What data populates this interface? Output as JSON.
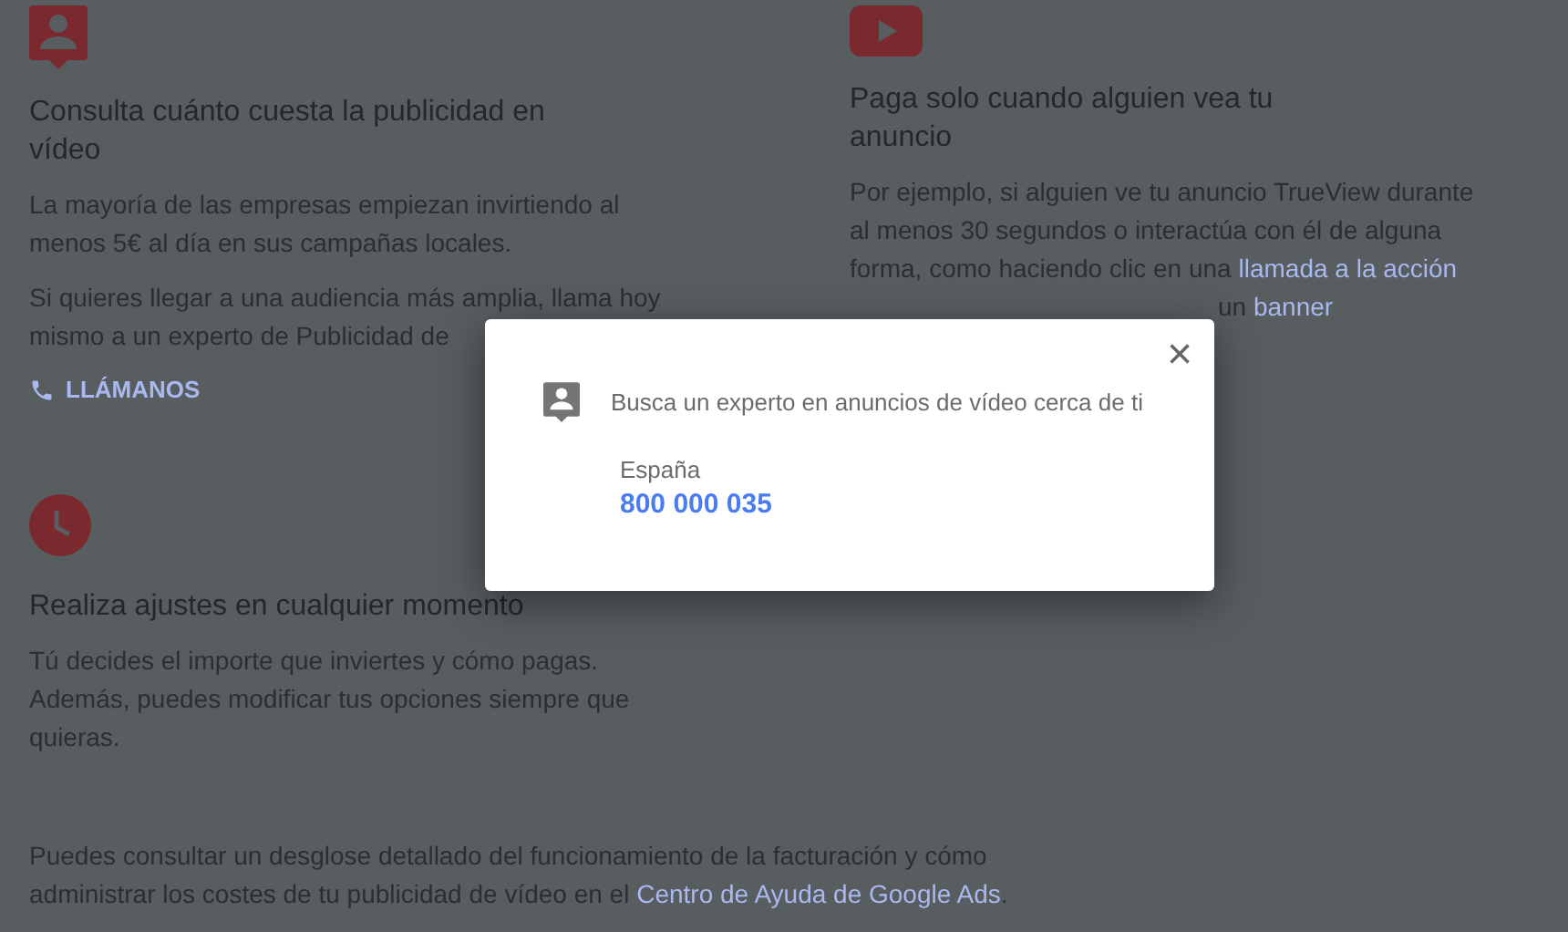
{
  "features": [
    {
      "title": "Consulta cuánto cuesta la publicidad en vídeo",
      "paragraphs": [
        {
          "covered_start": false,
          "segments": [
            {
              "kind": "text",
              "text": "La mayoría de las empresas empiezan invirtiendo al menos 5€ al día en sus campañas locales."
            }
          ]
        },
        {
          "covered_start": false,
          "segments": [
            {
              "kind": "text",
              "text": "Si quieres llegar a una audiencia más amplia, llama hoy mismo a un experto de Publicidad de"
            }
          ]
        }
      ],
      "action": {
        "label": "LLÁMANOS"
      }
    },
    {
      "title": "Paga solo cuando alguien vea tu anuncio",
      "paragraphs": [
        {
          "covered_start": false,
          "segments": [
            {
              "kind": "text",
              "text": "Por ejemplo, si alguien ve tu anuncio TrueView durante al menos 30 segundos o interactúa con él de alguna forma, como haciendo clic en una "
            },
            {
              "kind": "link",
              "text": "llamada a la acción"
            }
          ]
        },
        {
          "covered_start": true,
          "segments": [
            {
              "kind": "text",
              "text": "un "
            },
            {
              "kind": "link",
              "text": "banner"
            }
          ]
        }
      ]
    },
    {
      "title": "Realiza ajustes en cualquier momento",
      "paragraphs": [
        {
          "covered_start": false,
          "segments": [
            {
              "kind": "text",
              "text": "Tú decides el importe que inviertes y cómo pagas. Además, puedes modificar tus opciones siempre que quieras."
            }
          ]
        }
      ]
    }
  ],
  "footer": {
    "segments": [
      {
        "kind": "text",
        "text": "Puedes consultar un desglose detallado del funcionamiento de la facturación y cómo administrar los costes de tu publicidad de vídeo en el "
      },
      {
        "kind": "link",
        "text": "Centro de Ayuda de Google Ads"
      },
      {
        "kind": "text",
        "text": "."
      }
    ]
  },
  "dialog": {
    "close": "×",
    "heading": "Busca un experto en anuncios de vídeo cerca de ti",
    "country": "España",
    "phone": "800 000 035"
  }
}
